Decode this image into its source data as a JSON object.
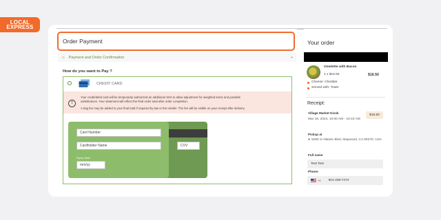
{
  "brand": {
    "logo_text": "LOCAL\nEXPRESS"
  },
  "order_payment": {
    "title": "Order Payment",
    "breadcrumb": "Payment and Order Confirmation",
    "question": "How do you want to Pay ?",
    "method_label": "CREDIT CARD",
    "notice_line1": "Your credit/debit card will be temporarily authorized an additional 15% to allow adjustment for weighted items and possible",
    "notice_line2": "substitutions. Your statement will reflect the final order total after order completion.",
    "notice_line3": "A bag fee may be added to your final total if required by law or the retailer. The fee will be visible on your receipt after delivery.",
    "card": {
      "number_placeholder": "Card Number",
      "holder_placeholder": "Cardholder Name",
      "expiry_label": "Expiry Date",
      "expiry_placeholder": "mm/yy",
      "cvv_placeholder": "CVV"
    }
  },
  "your_order": {
    "title": "Your order",
    "item": {
      "name": "Omelette with Bacon",
      "qty_price": "1 x $16.50",
      "total": "$16.50",
      "options": [
        "Cheese: Cheddar",
        "Served with: Toast"
      ]
    }
  },
  "receipt": {
    "title": "Receipt:",
    "store": "Village Market Kiosk",
    "date": "Mar 18, 2024, 10:00 AM - 10:10 AM",
    "price": "$16.50",
    "pickup_label": "Pickup at",
    "pickup_address": "5250 S Atlantic Blvd, Maywood, CA 90270, USA",
    "full_name_label": "Full name",
    "full_name_value": "Test Test",
    "phone_label": "Phone:",
    "phone_code": "+1",
    "phone_value": "501-338-7474"
  },
  "colors": {
    "accent": "#f26a2a",
    "green": "#8dbd6b",
    "dark_green": "#6e9a53"
  }
}
